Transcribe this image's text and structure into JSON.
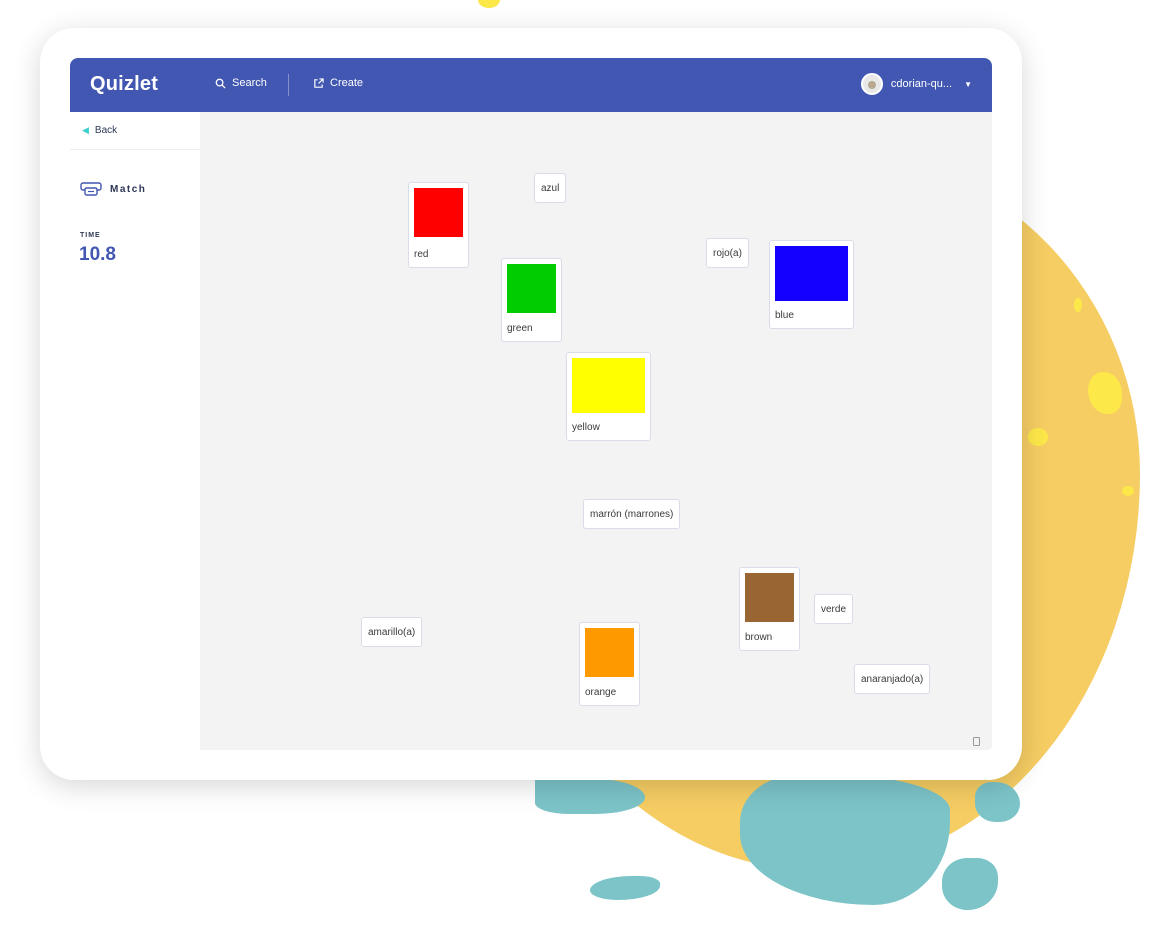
{
  "header": {
    "logo": "Quizlet",
    "search_label": "Search",
    "create_label": "Create",
    "username": "cdorian-qu..."
  },
  "sidebar": {
    "back_label": "Back",
    "mode_label": "Match",
    "time_label": "TIME",
    "time_value": "10.8"
  },
  "board": {
    "image_cards": [
      {
        "label": "red",
        "color": "#ff0000"
      },
      {
        "label": "green",
        "color": "#00cc00"
      },
      {
        "label": "blue",
        "color": "#1400ff"
      },
      {
        "label": "yellow",
        "color": "#ffff00"
      },
      {
        "label": "brown",
        "color": "#996633"
      },
      {
        "label": "orange",
        "color": "#ff9900"
      }
    ],
    "word_cards": [
      {
        "label": "azul"
      },
      {
        "label": "rojo(a)"
      },
      {
        "label": "marrón (marrones)"
      },
      {
        "label": "verde"
      },
      {
        "label": "amarillo(a)"
      },
      {
        "label": "anaranjado(a)"
      }
    ]
  },
  "colors": {
    "brand": "#4257b2",
    "accent": "#3ccfcf",
    "backdrop_yellow": "#f6cd63",
    "backdrop_teal": "#7cc4c8"
  }
}
